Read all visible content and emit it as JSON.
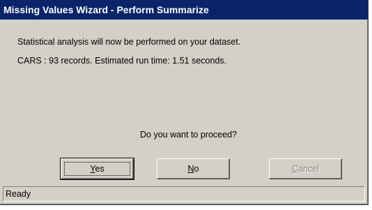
{
  "window": {
    "title": "Missing Values Wizard - Perform Summarize"
  },
  "message": {
    "line1": "Statistical analysis will now be performed on your dataset.",
    "line2": "CARS : 93 records. Estimated run time: 1.51 seconds."
  },
  "question": "Do you want to proceed?",
  "buttons": {
    "yes": {
      "accel": "Y",
      "rest": "es"
    },
    "no": {
      "accel": "N",
      "rest": "o"
    },
    "cancel": {
      "accel": "C",
      "rest": "ancel",
      "disabled": true
    }
  },
  "status": "Ready",
  "colors": {
    "title_bg": "#0a246a",
    "dialog_bg": "#d4d0c8",
    "disabled_text": "#808080"
  }
}
